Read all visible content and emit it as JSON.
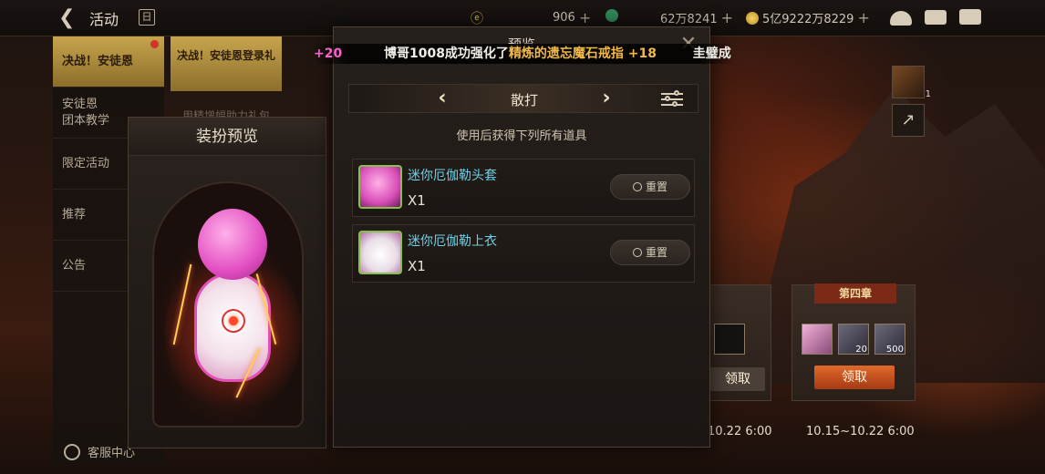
{
  "topbar": {
    "title": "活动",
    "resource_1": "906",
    "resource_2": "62万8241",
    "resource_3": "5亿9222万8229"
  },
  "left_nav": {
    "items": [
      {
        "label": "决战！安徒恩",
        "active": true
      },
      {
        "label": "安徒恩\n团本教学"
      },
      {
        "label": "限定活动"
      },
      {
        "label": "推荐"
      },
      {
        "label": "公告"
      }
    ],
    "sub_card": "决战！安徒恩登录礼",
    "sub_card_2": "用精增幅助力礼包",
    "service": "客服中心"
  },
  "costume_preview": {
    "title": "装扮预览"
  },
  "modal": {
    "title": "预览",
    "selector_label": "散打",
    "hint": "使用后获得下列所有道具",
    "items": [
      {
        "name": "迷你厄伽勒头套",
        "qty": "X1",
        "button": "重置"
      },
      {
        "name": "迷你厄伽勒上衣",
        "qty": "X1",
        "button": "重置"
      }
    ]
  },
  "marquee": {
    "prefix": "+20",
    "text": "博哥1008成功强化了",
    "item": "精炼的遗忘魔石戒指 +18",
    "suffix": "圭璧成"
  },
  "right_panel": {
    "side_icon_count": "1",
    "stage_4_tag": "第四章",
    "rewards": [
      {
        "count": ""
      },
      {
        "count": "20"
      },
      {
        "count": "500"
      }
    ],
    "claim_left": "领取",
    "claim_right": "领取",
    "date_left": "10.22 6:00",
    "date_right": "10.15~10.22 6:00"
  },
  "colors": {
    "gold": "#c7a44d",
    "item_name": "#6fd0e8",
    "marquee_pink": "#ff5fd0",
    "marquee_gold": "#f2b94a"
  }
}
